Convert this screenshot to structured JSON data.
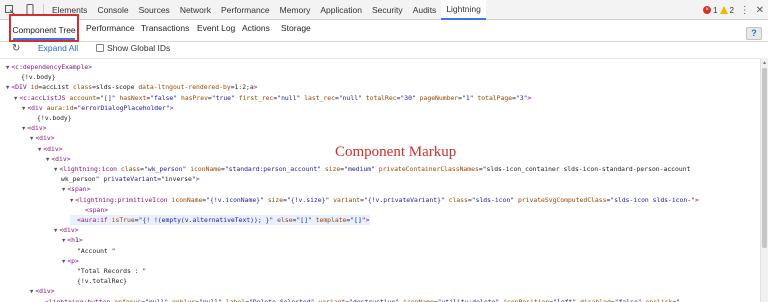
{
  "devtools": {
    "tabs": [
      "Elements",
      "Console",
      "Sources",
      "Network",
      "Performance",
      "Memory",
      "Application",
      "Security",
      "Audits",
      "Lightning"
    ],
    "active_tab": "Lightning",
    "error_count": "1",
    "warning_count": "2"
  },
  "lightning": {
    "tabs": {
      "component_tree": "Component Tree",
      "performance": "Performance",
      "transactions": "Transactions",
      "event_log": "Event Log",
      "actions": "Actions",
      "storage": "Storage"
    },
    "help": "?"
  },
  "toolbar": {
    "expand_all": "Expand All",
    "show_global_ids": "Show Global IDs"
  },
  "annotation": "Component Markup",
  "code_lines": [
    {
      "indent": 0,
      "tri": "▼",
      "text": "<c:dependencyExample>",
      "kind": "tag"
    },
    {
      "indent": 1,
      "tri": "",
      "text": "{!v.body}",
      "kind": "txt"
    },
    {
      "indent": 0,
      "tri": "▼",
      "text": "<DIV id=accList class=slds-scope data-ltngout-rendered-by=1:2;a>",
      "kind": "tag"
    },
    {
      "indent": 1,
      "tri": "▼",
      "text": "<c:accListJS account=\"[]\" hasNext=\"false\" hasPrev=\"true\" first_rec=\"null\" last_rec=\"null\" totalRec=\"30\" pageNumber=\"1\" totalPage=\"3\">",
      "kind": "mixed"
    },
    {
      "indent": 2,
      "tri": "▼",
      "text": "<div aura:id=\"errorDialogPlaceholder\">",
      "kind": "mixed"
    },
    {
      "indent": 3,
      "tri": "",
      "text": "{!v.body}",
      "kind": "txt"
    },
    {
      "indent": 2,
      "tri": "▼",
      "text": "<div>",
      "kind": "tag"
    },
    {
      "indent": 3,
      "tri": "▼",
      "text": "<div>",
      "kind": "tag"
    },
    {
      "indent": 4,
      "tri": "▼",
      "text": "<div>",
      "kind": "tag"
    },
    {
      "indent": 5,
      "tri": "▼",
      "text": "<div>",
      "kind": "tag"
    },
    {
      "indent": 6,
      "tri": "▼",
      "text": "<lightning:icon class=\"wk_person\" iconName=\"standard:person_account\" size=\"medium\" privateContainerClassNames=\"slds-icon_container slds-icon-standard-person-account",
      "kind": "mixed"
    },
    {
      "indent": 6,
      "tri": "",
      "text": "wk_person\" privateVariant=\"inverse\">",
      "kind": "mixed"
    },
    {
      "indent": 7,
      "tri": "▼",
      "text": "<span>",
      "kind": "tag"
    },
    {
      "indent": 8,
      "tri": "▼",
      "text": "<lightning:primitiveIcon iconName=\"{!v.iconName}\" size=\"{!v.size}\" variant=\"{!v.privateVariant}\" class=\"slds-icon\" privateSvgComputedClass=\"slds-icon slds-icon-\">",
      "kind": "mixed"
    },
    {
      "indent": 9,
      "tri": "",
      "text": "<span>",
      "kind": "tag"
    },
    {
      "indent": 8,
      "tri": "",
      "text": "<aura:if isTrue=\"{! !(empty(v.alternativeText)); }\" else=\"[]\" template=\"[]\">",
      "kind": "mixed",
      "highlight": true
    },
    {
      "indent": 6,
      "tri": "▼",
      "text": "<div>",
      "kind": "tag"
    },
    {
      "indent": 7,
      "tri": "▼",
      "text": "<h1>",
      "kind": "tag"
    },
    {
      "indent": 8,
      "tri": "",
      "text": "\"Account \"",
      "kind": "txt"
    },
    {
      "indent": 7,
      "tri": "▼",
      "text": "<p>",
      "kind": "tag"
    },
    {
      "indent": 8,
      "tri": "",
      "text": "\"Total Records : \"",
      "kind": "txt"
    },
    {
      "indent": 8,
      "tri": "",
      "text": "{!v.totalRec}",
      "kind": "txt"
    },
    {
      "indent": 3,
      "tri": "▼",
      "text": "<div>",
      "kind": "tag"
    },
    {
      "indent": 4,
      "tri": "",
      "text": "<lightning:button onfocus=\"null\" onblur=\"null\" label=\"Delete Selected\" variant=\"destructive\" iconName=\"utility:delete\" iconPosition=\"left\" disabled=\"false\" onclick=\"",
      "kind": "mixed"
    }
  ]
}
